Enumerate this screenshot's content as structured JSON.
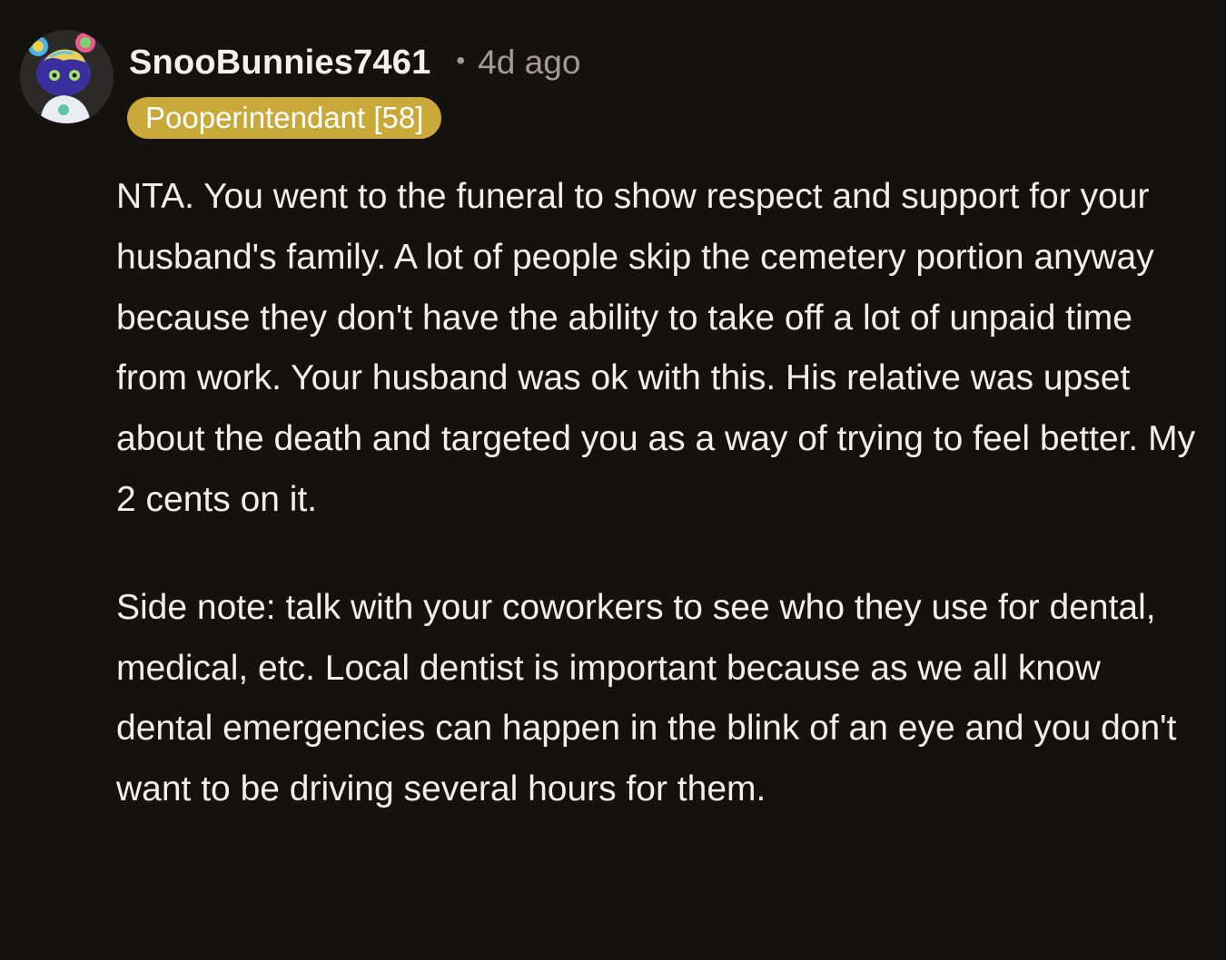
{
  "comment": {
    "author": "SnooBunnies7461",
    "separator": "•",
    "timestamp": "4d ago",
    "flair": "Pooperintendant [58]",
    "avatar_icon": "snoo-avatar-icon",
    "paragraphs": [
      "NTA. You went to the funeral to show respect and support for your husband's family. A lot of people skip the cemetery portion anyway because they don't have the ability to take off a lot of unpaid time from work. Your husband was ok with this. His relative was upset about the death and targeted you as a way of trying to feel better. My 2 cents on it.",
      "Side note: talk with your coworkers to see who they use for dental, medical, etc. Local dentist is important because as we all know dental emergencies can happen in the blink of an eye and you don't want to be driving several hours for them."
    ]
  },
  "colors": {
    "background": "#15110f",
    "text": "#f2eeea",
    "meta": "#a39c96",
    "flair_bg": "#c9a93a"
  }
}
